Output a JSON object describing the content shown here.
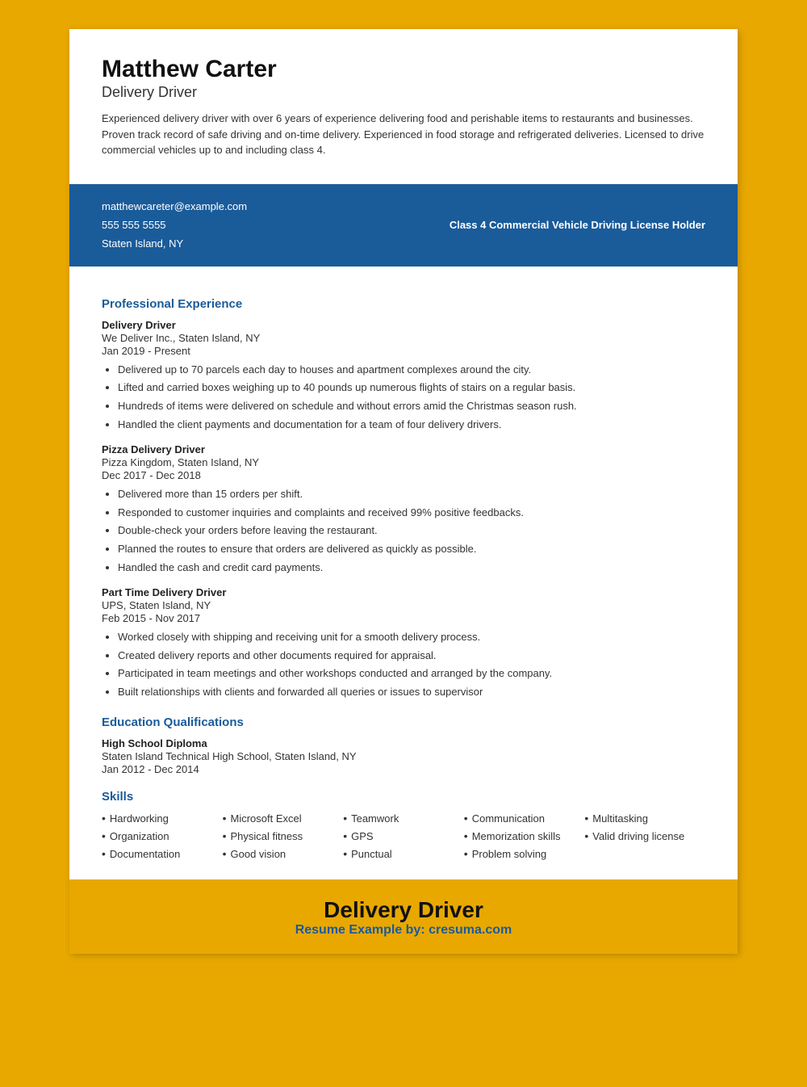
{
  "header": {
    "name": "Matthew Carter",
    "job_title": "Delivery Driver",
    "summary": "Experienced delivery driver with over 6 years of experience delivering food and perishable items to restaurants and businesses. Proven track record of safe driving and on-time delivery. Experienced in food storage and refrigerated deliveries. Licensed to drive commercial vehicles up to and including class 4."
  },
  "contact": {
    "email": "matthewcareter@example.com",
    "phone": "555 555 5555",
    "location": "Staten Island, NY",
    "credential": "Class 4 Commercial Vehicle Driving License Holder"
  },
  "experience_title": "Professional Experience",
  "jobs": [
    {
      "title": "Delivery Driver",
      "company": "We Deliver Inc., Staten Island, NY",
      "dates": "Jan 2019 - Present",
      "bullets": [
        "Delivered up to 70 parcels each day to houses and apartment complexes around the city.",
        "Lifted and carried boxes weighing up to 40 pounds up numerous flights of stairs on a regular basis.",
        "Hundreds of items were delivered on schedule and without errors amid the Christmas season rush.",
        "Handled the client payments and documentation for a team of four delivery drivers."
      ]
    },
    {
      "title": "Pizza Delivery Driver",
      "company": "Pizza Kingdom, Staten Island, NY",
      "dates": "Dec 2017 - Dec 2018",
      "bullets": [
        "Delivered more than 15 orders per shift.",
        "Responded to customer inquiries and complaints and received 99% positive feedbacks.",
        "Double-check your orders before leaving the restaurant.",
        "Planned the routes to ensure that orders are delivered as quickly as possible.",
        "Handled the cash and credit card payments."
      ]
    },
    {
      "title": "Part Time Delivery Driver",
      "company": "UPS, Staten Island, NY",
      "dates": "Feb 2015 - Nov 2017",
      "bullets": [
        "Worked closely with shipping and receiving unit for a smooth delivery process.",
        "Created delivery reports and other documents required for appraisal.",
        "Participated in team meetings and other workshops conducted and arranged by the company.",
        "Built relationships with clients and forwarded all queries or issues to supervisor"
      ]
    }
  ],
  "education_title": "Education Qualifications",
  "education": [
    {
      "degree": "High School Diploma",
      "school": "Staten Island Technical High School, Staten Island, NY",
      "dates": "Jan 2012 - Dec 2014"
    }
  ],
  "skills_title": "Skills",
  "skills": [
    "Hardworking",
    "Microsoft Excel",
    "Teamwork",
    "Communication",
    "Multitasking",
    "Organization",
    "Physical fitness",
    "GPS",
    "Memorization skills",
    "Valid driving license",
    "Documentation",
    "Good vision",
    "Punctual",
    "Problem solving"
  ],
  "footer": {
    "title": "Delivery Driver",
    "subtitle": "Resume Example by:",
    "brand": "cresuma.com"
  }
}
